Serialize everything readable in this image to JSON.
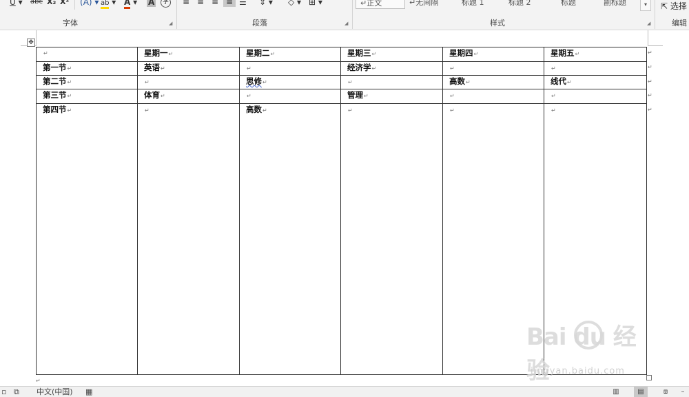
{
  "ribbon": {
    "font_group": {
      "label": "字体",
      "underline": "U",
      "strikethrough": "abc",
      "subscript": "X₂",
      "superscript": "X²",
      "text_effects": "A",
      "highlight": "ab",
      "font_color": "A",
      "char_shading": "A",
      "enclose_char": "字"
    },
    "paragraph_group": {
      "label": "段落"
    },
    "styles_group": {
      "label": "样式",
      "items": [
        "↵正文",
        "↵无间隔",
        "标题 1",
        "标题 2",
        "标题",
        "副标题"
      ]
    },
    "editing_group": {
      "label": "编辑",
      "select_label": "选择"
    }
  },
  "table": {
    "rows": [
      [
        "",
        "星期一",
        "星期二",
        "星期三",
        "星期四",
        "星期五"
      ],
      [
        "第一节",
        "英语",
        "",
        "经济学",
        "",
        ""
      ],
      [
        "第二节",
        "",
        "思修",
        "",
        "高数",
        "线代"
      ],
      [
        "第三节",
        "体育",
        "",
        "管理",
        "",
        ""
      ],
      [
        "第四节",
        "",
        "高数",
        "",
        "",
        ""
      ]
    ],
    "cell_mark": "↵",
    "row_mark": "↵"
  },
  "statusbar": {
    "language": "中文(中国)"
  },
  "watermark": {
    "logo": "Bai du 经验",
    "url": "jingyan.baidu.com"
  },
  "colors": {
    "ribbon_bg": "#f3f3f3",
    "accent_font_color": "#d83b01",
    "highlight_yellow": "#ffd800",
    "text_effect_blue": "#2b579a"
  }
}
